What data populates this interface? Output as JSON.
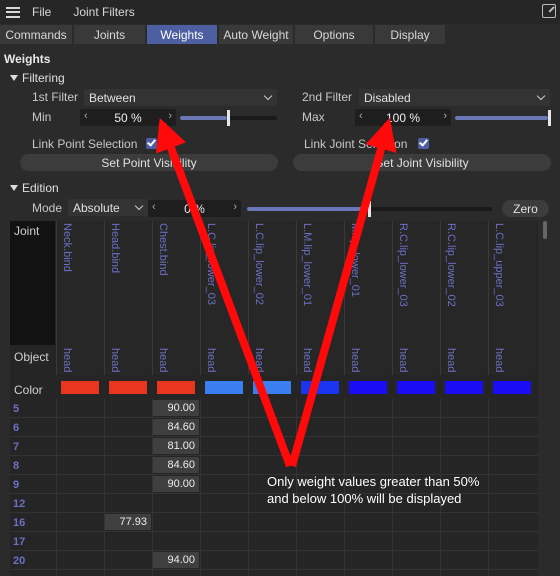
{
  "menubar": {
    "items": [
      "File",
      "Joint Filters"
    ]
  },
  "tabs": [
    {
      "label": "Commands",
      "active": false
    },
    {
      "label": "Joints",
      "active": false
    },
    {
      "label": "Weights",
      "active": true
    },
    {
      "label": "Auto Weight",
      "active": false
    },
    {
      "label": "Options",
      "active": false
    },
    {
      "label": "Display",
      "active": false
    }
  ],
  "section_title": "Weights",
  "filtering": {
    "title": "Filtering",
    "filter1_label": "1st Filter",
    "filter1_value": "Between",
    "filter2_label": "2nd Filter",
    "filter2_value": "Disabled",
    "min_label": "Min",
    "min_value": "50 %",
    "min_fraction": 0.5,
    "max_label": "Max",
    "max_value": "100 %",
    "max_fraction": 1.0,
    "link_point_label": "Link Point Selection",
    "link_joint_label": "Link Joint Selection",
    "link_point_checked": true,
    "link_joint_checked": true,
    "set_point_button": "Set Point Visibility",
    "set_joint_button": "Set Joint Visibility"
  },
  "edition": {
    "title": "Edition",
    "mode_label": "Mode",
    "mode_value": "Absolute",
    "value": "0 %",
    "value_fraction": 0.5,
    "zero_button": "Zero"
  },
  "table": {
    "joint_header": "Joint",
    "object_label": "Object",
    "color_label": "Color",
    "columns": [
      {
        "joint": "Neck.bind",
        "object": "head",
        "color": "#e8361f"
      },
      {
        "joint": "Head.bind",
        "object": "head",
        "color": "#e8361f"
      },
      {
        "joint": "Chest.bind",
        "object": "head",
        "color": "#e8361f"
      },
      {
        "joint": "L.C.lip_lower_03",
        "object": "head",
        "color": "#3a7ff2"
      },
      {
        "joint": "L.C.lip_lower_02",
        "object": "head",
        "color": "#3a7ff2"
      },
      {
        "joint": "L.M.lip_lower_01",
        "object": "head",
        "color": "#1a35f0"
      },
      {
        "joint": "M.lip_lower_01",
        "object": "head",
        "color": "#1a0cf5"
      },
      {
        "joint": "R.C.lip_lower_03",
        "object": "head",
        "color": "#1a0cf5"
      },
      {
        "joint": "R.C.lip_lower_02",
        "object": "head",
        "color": "#1a0cf5"
      },
      {
        "joint": "L.C.lip_upper_03",
        "object": "head",
        "color": "#1a0cf5"
      }
    ],
    "rows": [
      {
        "label": "5",
        "cells": {
          "2": "90.00"
        }
      },
      {
        "label": "6",
        "cells": {
          "2": "84.60"
        }
      },
      {
        "label": "7",
        "cells": {
          "2": "81.00"
        }
      },
      {
        "label": "8",
        "cells": {
          "2": "84.60"
        }
      },
      {
        "label": "9",
        "cells": {
          "2": "90.00"
        }
      },
      {
        "label": "12",
        "cells": {}
      },
      {
        "label": "16",
        "cells": {
          "1": "77.93"
        }
      },
      {
        "label": "17",
        "cells": {}
      },
      {
        "label": "20",
        "cells": {
          "2": "94.00"
        }
      }
    ]
  },
  "annotation": {
    "line1": "Only weight values greater than 50%",
    "line2": "and below 100% will be displayed",
    "arrow_color": "#ff0a0a"
  }
}
